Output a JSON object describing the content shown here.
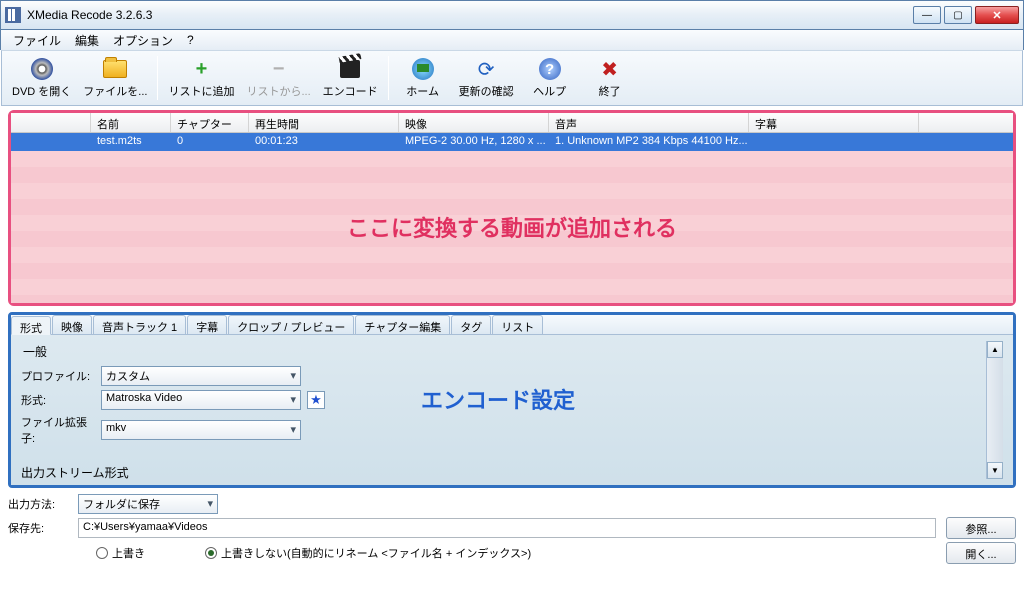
{
  "window": {
    "title": "XMedia Recode 3.2.6.3"
  },
  "menu": {
    "file": "ファイル",
    "edit": "編集",
    "options": "オプション",
    "help": "?"
  },
  "toolbar": {
    "open_dvd": "DVD を開く",
    "open_file": "ファイルを...",
    "add_list": "リストに追加",
    "remove_list": "リストから...",
    "encode": "エンコード",
    "home": "ホーム",
    "check_update": "更新の確認",
    "help": "ヘルプ",
    "exit": "終了"
  },
  "filelist": {
    "headers": {
      "name": "名前",
      "chapter": "チャプター",
      "duration": "再生時間",
      "video": "映像",
      "audio": "音声",
      "subtitle": "字幕"
    },
    "row": {
      "name": "test.m2ts",
      "chapter": "0",
      "duration": "00:01:23",
      "video": "MPEG-2 30.00 Hz, 1280 x ...",
      "audio": "1. Unknown MP2 384 Kbps 44100 Hz...",
      "subtitle": ""
    },
    "annotation": "ここに変換する動画が追加される"
  },
  "tabs": {
    "format": "形式",
    "video": "映像",
    "audio": "音声トラック 1",
    "subtitle": "字幕",
    "crop": "クロップ / プレビュー",
    "chapter": "チャプター編集",
    "tag": "タグ",
    "list": "リスト"
  },
  "settings": {
    "group_general": "一般",
    "profile_label": "プロファイル:",
    "profile_value": "カスタム",
    "format_label": "形式:",
    "format_value": "Matroska Video",
    "ext_label": "ファイル拡張子:",
    "ext_value": "mkv",
    "out_stream": "出力ストリーム形式",
    "annotation": "エンコード設定"
  },
  "output": {
    "method_label": "出力方法:",
    "method_value": "フォルダに保存",
    "dest_label": "保存先:",
    "dest_value": "C:¥Users¥yamaa¥Videos",
    "browse": "参照...",
    "overwrite": "上書き",
    "no_overwrite": "上書きしない(自動的にリネーム <ファイル名 + インデックス>)",
    "open": "開く..."
  }
}
